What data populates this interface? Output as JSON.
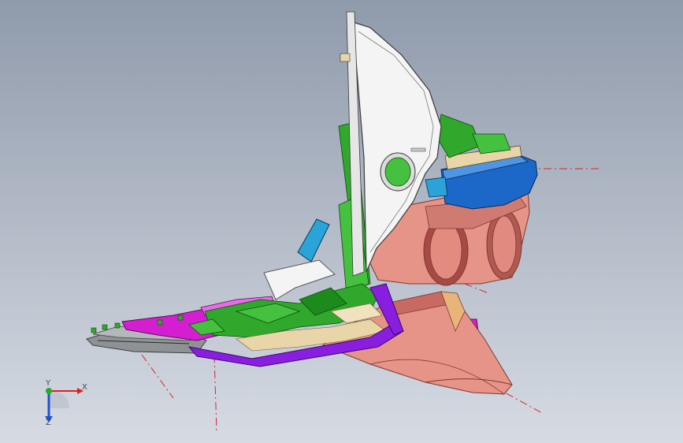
{
  "viewport": {
    "background_top": "#8f9aab",
    "background_bottom": "#d6dbe3"
  },
  "model": {
    "colors": {
      "white_shell": "#f4f4f4",
      "green_parts": "#2fa82c",
      "salmon_duct": "#e79488",
      "salmon_dark": "#c76a62",
      "blue_cap": "#1b68c9",
      "cyan_band": "#2aa3d8",
      "magenta_tray": "#d41fd1",
      "purple_edge": "#8a1ee0",
      "grey_base": "#8e9294",
      "beige_fill": "#e9d6a8",
      "centerline_red": "#d8262a"
    }
  },
  "triad": {
    "x_label": "X",
    "y_label": "Y",
    "z_label": "Z",
    "x_color": "#e02020",
    "y_color": "#20b020",
    "z_color": "#2050d0"
  }
}
